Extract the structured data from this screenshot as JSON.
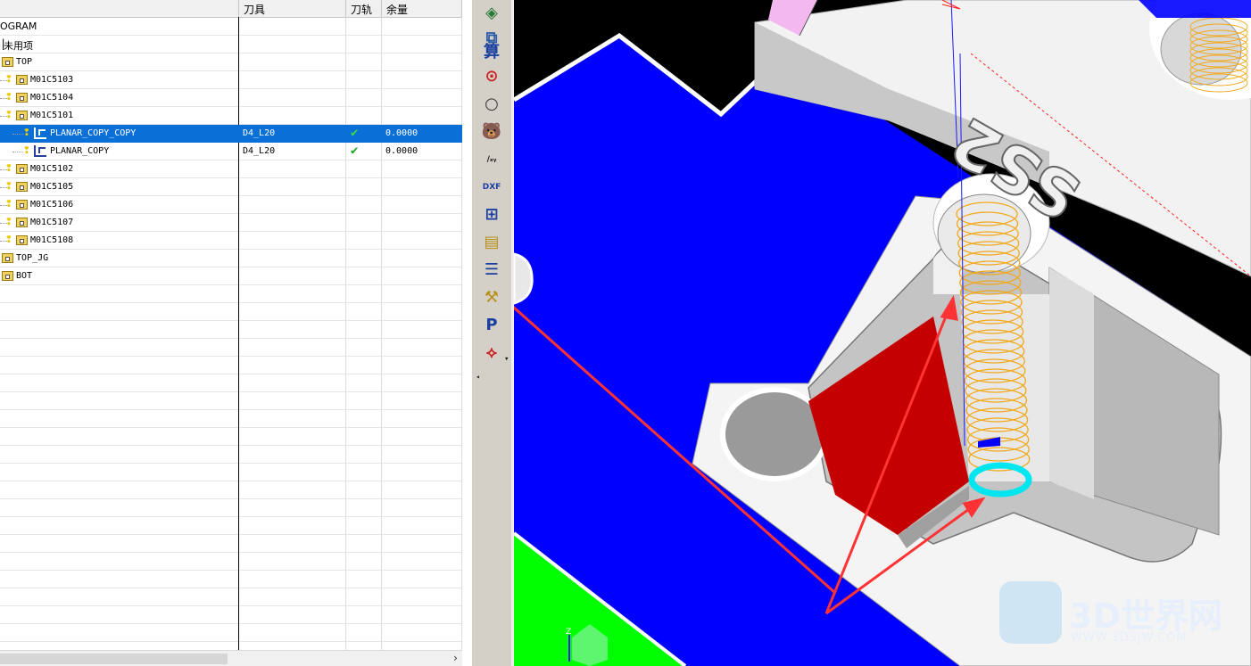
{
  "navigator": {
    "columns": [
      "",
      "刀具",
      "刀轨",
      "余量"
    ],
    "rows": [
      {
        "name": "OGRAM",
        "indent": 0,
        "type": "none"
      },
      {
        "name": "未用项",
        "indent": 0,
        "type": "bracket"
      },
      {
        "name": "TOP",
        "indent": 1,
        "type": "folder"
      },
      {
        "name": "M01C5103",
        "indent": 2,
        "type": "bulb-folder"
      },
      {
        "name": "M01C5104",
        "indent": 2,
        "type": "bulb-folder"
      },
      {
        "name": "M01C5101",
        "indent": 2,
        "type": "bulb-folder"
      },
      {
        "name": "PLANAR_COPY_COPY",
        "indent": 3,
        "type": "bulb-op",
        "tool": "D4_L20",
        "check": "✔",
        "stock": "0.0000",
        "selected": true
      },
      {
        "name": "PLANAR_COPY",
        "indent": 3,
        "type": "bulb-op",
        "tool": "D4_L20",
        "check": "✔",
        "stock": "0.0000"
      },
      {
        "name": "M01C5102",
        "indent": 2,
        "type": "bulb-folder"
      },
      {
        "name": "M01C5105",
        "indent": 2,
        "type": "bulb-folder"
      },
      {
        "name": "M01C5106",
        "indent": 2,
        "type": "bulb-folder"
      },
      {
        "name": "M01C5107",
        "indent": 2,
        "type": "bulb-folder"
      },
      {
        "name": "M01C5108",
        "indent": 2,
        "type": "bulb-folder"
      },
      {
        "name": "TOP_JG",
        "indent": 1,
        "type": "folder"
      },
      {
        "name": "BOT",
        "indent": 1,
        "type": "folder"
      }
    ],
    "scroll_arrow": "›"
  },
  "toolbar": {
    "buttons": [
      {
        "name": "layer-icon",
        "glyph": "◈",
        "color": "#2b7a3a"
      },
      {
        "name": "stack-icon",
        "glyph": "⧉",
        "color": "#2a5aa8"
      },
      {
        "name": "compute-icon",
        "glyph": "算",
        "color": "#1a3fa0"
      },
      {
        "name": "target-icon",
        "glyph": "⊙",
        "color": "#c22"
      },
      {
        "name": "circle-icon",
        "glyph": "○",
        "color": "#333"
      },
      {
        "name": "bear-icon",
        "glyph": "🐻",
        "color": "#c33"
      },
      {
        "name": "xyz-icon",
        "glyph": "∕ₓᵧ",
        "color": "#111"
      },
      {
        "name": "dxf-icon",
        "glyph": "DXF",
        "color": "#1a3fa0"
      },
      {
        "name": "tree-icon",
        "glyph": "⊞",
        "color": "#1a3fa0"
      },
      {
        "name": "stack-yellow-icon",
        "glyph": "▤",
        "color": "#b8901a"
      },
      {
        "name": "list-icon",
        "glyph": "☰",
        "color": "#1a3fa0"
      },
      {
        "name": "tool-icon",
        "glyph": "⚒",
        "color": "#b8901a"
      },
      {
        "name": "post-nc-icon",
        "glyph": "P",
        "color": "#1a3fa0"
      },
      {
        "name": "path-icon",
        "glyph": "⟡",
        "color": "#c22"
      }
    ],
    "dropdown_arrow": "▾",
    "left_arrow": "◂"
  },
  "viewport": {
    "engraving": "SS2",
    "triad_label": "Z",
    "colors": {
      "floor": "#0000ff",
      "wall_red": "#c40000",
      "green": "#00ff00",
      "helix": "#f2a81a",
      "cyan": "#00e6f0",
      "arrow": "#ff3333"
    }
  },
  "watermark": {
    "brand": "3D世界网",
    "url": "WWW.3DSJW.COM"
  }
}
